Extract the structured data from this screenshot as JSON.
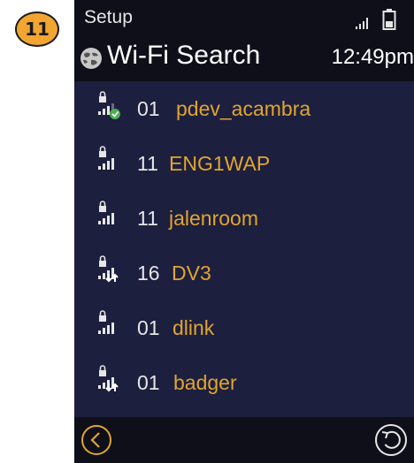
{
  "step_badge": "11",
  "status_bar": {
    "title": "Setup",
    "signal_icon": "signal-bars-icon",
    "battery_icon": "battery-icon"
  },
  "header": {
    "icon": "globe-icon",
    "title": "Wi-Fi Search",
    "time": "12:49pm"
  },
  "networks": [
    {
      "channel": "01",
      "ssid": "pdev_acambra",
      "icon": "lock-signal-connected-icon"
    },
    {
      "channel": "11",
      "ssid": "ENG1WAP",
      "icon": "lock-signal-icon"
    },
    {
      "channel": "11",
      "ssid": "jalenroom",
      "icon": "lock-signal-icon"
    },
    {
      "channel": "16",
      "ssid": "DV3",
      "icon": "lock-signal-download-icon"
    },
    {
      "channel": "01",
      "ssid": "dlink",
      "icon": "lock-signal-icon"
    },
    {
      "channel": "01",
      "ssid": "badger",
      "icon": "lock-signal-download-icon"
    }
  ],
  "bottom_bar": {
    "back_icon": "chevron-left-circle-icon",
    "refresh_icon": "rotate-ccw-icon"
  },
  "colors": {
    "background": "#1d1f3e",
    "bar": "#0e0f19",
    "ssid": "#e0a531",
    "badge": "#f2a531",
    "connected": "#4caf50"
  }
}
